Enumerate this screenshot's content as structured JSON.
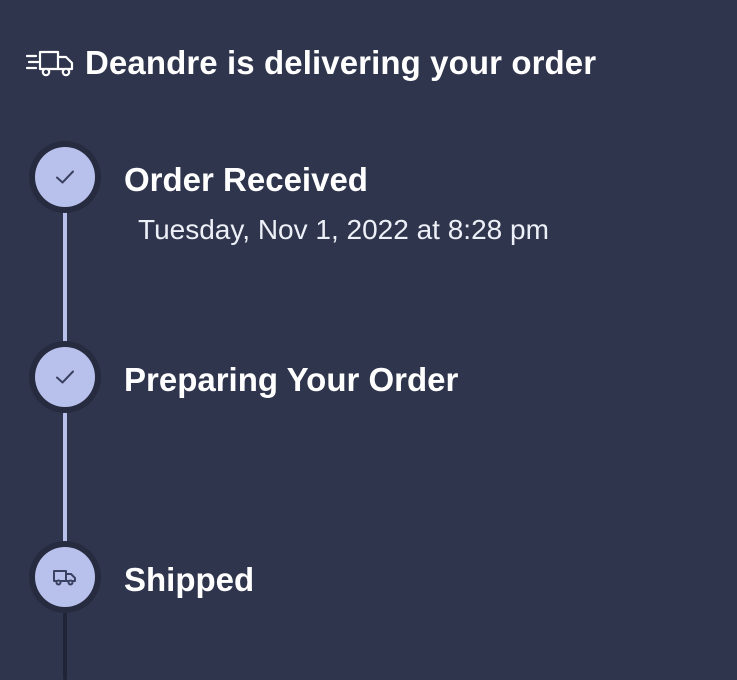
{
  "header": {
    "icon": "delivery-truck-icon",
    "title": "Deandre is delivering your order"
  },
  "colors": {
    "background": "#2f354d",
    "accent": "#b8c1ec",
    "ring": "#262b3f",
    "text": "#ffffff"
  },
  "timeline": {
    "steps": [
      {
        "title": "Order Received",
        "subtitle": "Tuesday, Nov 1, 2022 at 8:28 pm",
        "icon": "check-icon",
        "status": "complete"
      },
      {
        "title": "Preparing Your Order",
        "subtitle": "",
        "icon": "check-icon",
        "status": "complete"
      },
      {
        "title": "Shipped",
        "subtitle": "",
        "icon": "truck-icon",
        "status": "current"
      }
    ]
  }
}
